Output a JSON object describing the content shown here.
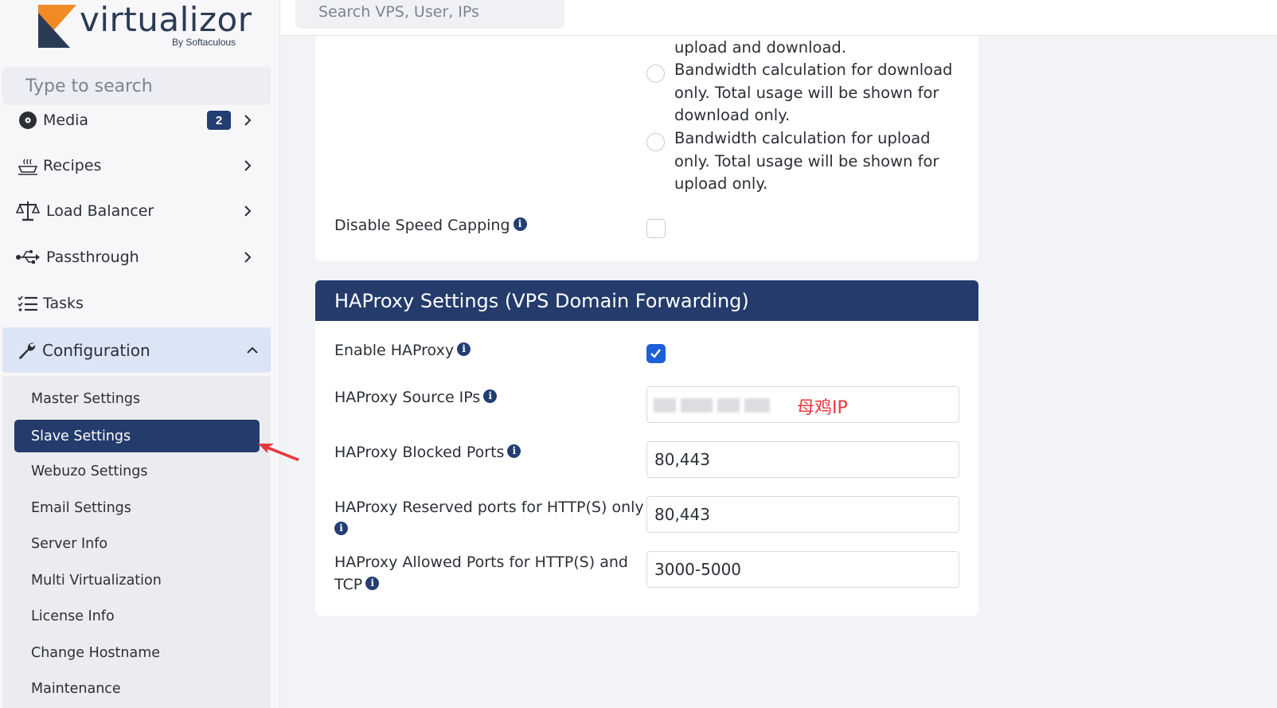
{
  "brand": {
    "name": "virtualizor",
    "byline": "By Softaculous"
  },
  "sidebar": {
    "search_placeholder": "Type to search",
    "items": [
      {
        "label": "Media",
        "icon": "disc-icon",
        "badge": "2"
      },
      {
        "label": "Recipes",
        "icon": "cooking-pot-icon"
      },
      {
        "label": "Load Balancer",
        "icon": "scale-icon"
      },
      {
        "label": "Passthrough",
        "icon": "usb-icon"
      },
      {
        "label": "Tasks",
        "icon": "task-list-icon"
      }
    ],
    "configuration": {
      "label": "Configuration",
      "icon": "wrench-icon",
      "submenu": [
        "Master Settings",
        "Slave Settings",
        "Webuzo Settings",
        "Email Settings",
        "Server Info",
        "Multi Virtualization",
        "License Info",
        "Change Hostname",
        "Maintenance"
      ],
      "active": "Slave Settings"
    }
  },
  "topbar": {
    "search_placeholder": "Search VPS, User, IPs"
  },
  "bandwidth": {
    "partial_text": "upload and download.",
    "options": [
      "Bandwidth calculation for download only. Total usage will be shown for download only.",
      "Bandwidth calculation for upload only. Total usage will be shown for upload only."
    ],
    "disable_speed_capping_label": "Disable Speed Capping"
  },
  "haproxy": {
    "title": "HAProxy Settings (VPS Domain Forwarding)",
    "enable_label": "Enable HAProxy",
    "enable_checked": true,
    "source_ips_label": "HAProxy Source IPs",
    "source_ips_note": "母鸡IP",
    "blocked_ports_label": "HAProxy Blocked Ports",
    "blocked_ports_value": "80,443",
    "reserved_ports_label": "HAProxy Reserved ports for HTTP(S) only",
    "reserved_ports_value": "80,443",
    "allowed_ports_label_line1": "HAProxy Allowed Ports for HTTP(S) and",
    "allowed_ports_label_line2": "TCP",
    "allowed_ports_value": "3000-5000"
  },
  "colors": {
    "navy": "#243b6b",
    "accent_blue": "#1d5fd6",
    "annotation_red": "#e8373d",
    "logo_orange": "#f08a24"
  }
}
